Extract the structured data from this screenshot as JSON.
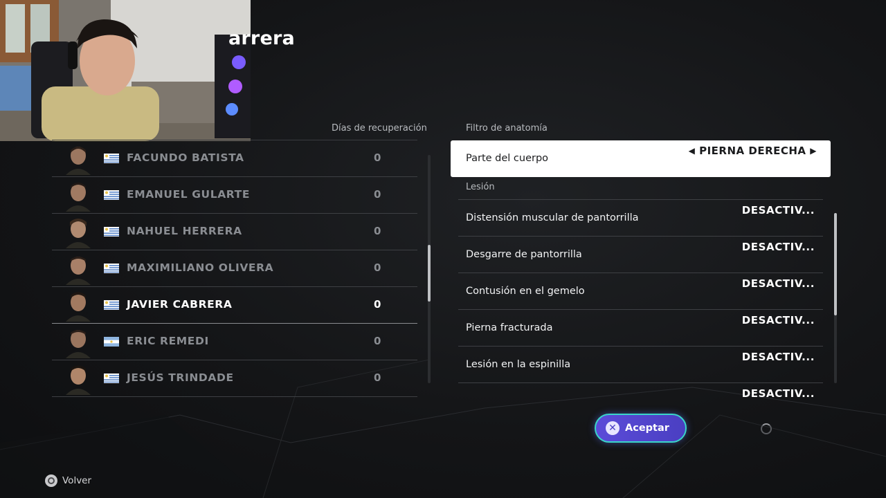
{
  "page_title": "arrera",
  "columns": {
    "recovery_days": "Días de recuperación",
    "anatomy_filter": "Filtro de anatomía"
  },
  "players": [
    {
      "name": "FACUNDO BATISTA",
      "days": "0",
      "flag": "uruguay",
      "selected": false
    },
    {
      "name": "EMANUEL GULARTE",
      "days": "0",
      "flag": "uruguay",
      "selected": false
    },
    {
      "name": "NAHUEL HERRERA",
      "days": "0",
      "flag": "uruguay",
      "selected": false
    },
    {
      "name": "MAXIMILIANO OLIVERA",
      "days": "0",
      "flag": "uruguay",
      "selected": false
    },
    {
      "name": "JAVIER CABRERA",
      "days": "0",
      "flag": "uruguay",
      "selected": true
    },
    {
      "name": "ERIC REMEDI",
      "days": "0",
      "flag": "argentina",
      "selected": false
    },
    {
      "name": "JESÚS TRINDADE",
      "days": "0",
      "flag": "uruguay",
      "selected": false
    }
  ],
  "body_part": {
    "label": "Parte del cuerpo",
    "value": "PIERNA DERECHA",
    "left_arrow": "◀",
    "right_arrow": "▶"
  },
  "injury_section_label": "Lesión",
  "injuries": [
    {
      "name": "Distensión muscular de pantorrilla",
      "state": "DESACTIV..."
    },
    {
      "name": "Desgarre de pantorrilla",
      "state": "DESACTIV..."
    },
    {
      "name": "Contusión en el gemelo",
      "state": "DESACTIV..."
    },
    {
      "name": "Pierna fracturada",
      "state": "DESACTIV..."
    },
    {
      "name": "Lesión en la espinilla",
      "state": "DESACTIV..."
    },
    {
      "name": "",
      "state": "DESACTIV..."
    }
  ],
  "accept_button": {
    "label": "Aceptar",
    "icon": "cross-button-icon"
  },
  "back_hint": {
    "label": "Volver",
    "icon": "circle-button-icon"
  },
  "colors": {
    "accent_purple": "#5b4bd8",
    "accent_teal": "#3ad6c8",
    "selected_text": "#ffffff",
    "dim_text": "#8a8d92"
  }
}
